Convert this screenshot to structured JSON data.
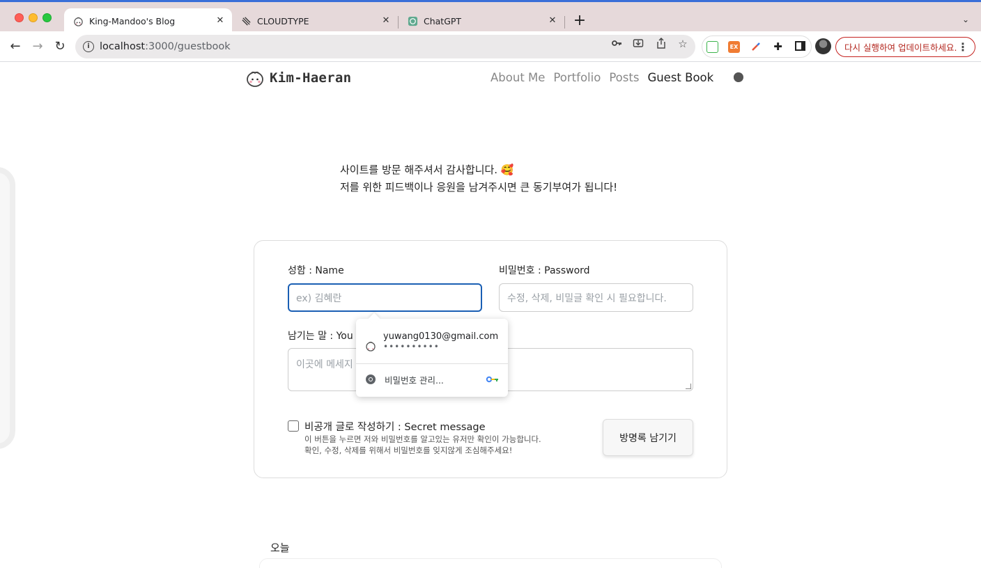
{
  "browser": {
    "tabs": [
      {
        "title": "King-Mandoo's Blog",
        "active": true
      },
      {
        "title": "CLOUDTYPE",
        "active": false
      },
      {
        "title": "ChatGPT",
        "active": false
      }
    ],
    "url_host": "localhost",
    "url_path": ":3000/guestbook",
    "update_button": "다시 실행하여 업데이트하세요.",
    "ext_label": "EX",
    "icons": [
      "back-icon",
      "forward-icon",
      "reload-icon",
      "info-icon",
      "key-icon",
      "install-icon",
      "share-icon",
      "bookmark-star-icon",
      "extensions-puzzle-icon",
      "side-panel-icon",
      "more-vert-icon"
    ]
  },
  "site": {
    "logo_text": "Kim-Haeran",
    "nav": [
      "About Me",
      "Portfolio",
      "Posts",
      "Guest Book"
    ],
    "active_nav": "Guest Book"
  },
  "intro": {
    "line1": "사이트를 방문 해주셔서 감사합니다. 🥰",
    "line2": "저를 위한 피드백이나 응원을 남겨주시면 큰 동기부여가 됩니다!"
  },
  "form": {
    "name_label": "성함 : Name",
    "name_placeholder": "ex) 김혜란",
    "password_label": "비밀번호 : Password",
    "password_placeholder": "수정, 삭제, 비밀글 확인 시 필요합니다.",
    "message_label": "남기는 말 : You",
    "message_placeholder": "이곳에 메세지",
    "secret_title": "비공개 글로 작성하기 : Secret message",
    "secret_desc1": "이 버튼을 누르면 저와 비밀번호를 알고있는 유저만 확인이 가능합니다.",
    "secret_desc2": "확인, 수정, 삭제를 위해서 비밀번호를 잊지않게 조심해주세요!",
    "submit_label": "방명록 남기기"
  },
  "autofill": {
    "email": "yuwang0130@gmail.com",
    "password_mask": "••••••••••",
    "manage_label": "비밀번호 관리..."
  },
  "today_label": "오늘"
}
